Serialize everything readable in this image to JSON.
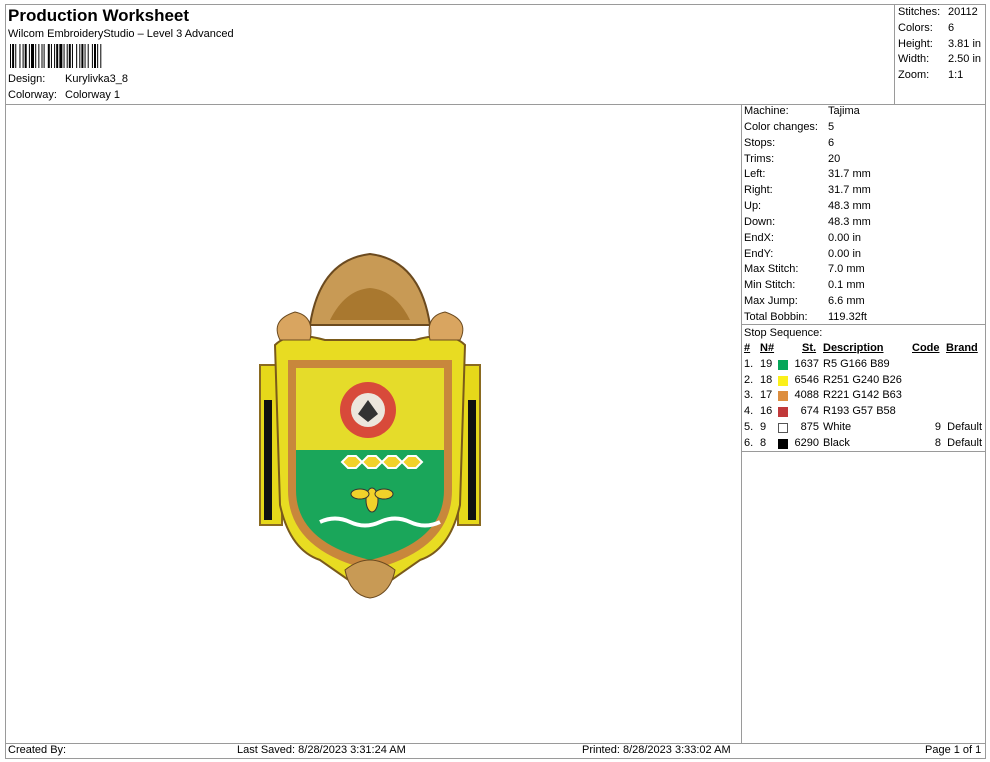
{
  "header": {
    "title": "Production Worksheet",
    "software": "Wilcom EmbroideryStudio – Level 3 Advanced",
    "design_label": "Design:",
    "design_value": "Kurylivka3_8",
    "colorway_label": "Colorway:",
    "colorway_value": "Colorway 1"
  },
  "summary": [
    {
      "label": "Stitches:",
      "value": "20112"
    },
    {
      "label": "Colors:",
      "value": "6"
    },
    {
      "label": "Height:",
      "value": "3.81 in"
    },
    {
      "label": "Width:",
      "value": "2.50 in"
    },
    {
      "label": "Zoom:",
      "value": "1:1"
    }
  ],
  "machine_stats": [
    {
      "label": "Machine:",
      "value": "Tajima"
    },
    {
      "label": "Color changes:",
      "value": "5"
    },
    {
      "label": "Stops:",
      "value": "6"
    },
    {
      "label": "Trims:",
      "value": "20"
    },
    {
      "label": "Left:",
      "value": "31.7 mm"
    },
    {
      "label": "Right:",
      "value": "31.7 mm"
    },
    {
      "label": "Up:",
      "value": "48.3 mm"
    },
    {
      "label": "Down:",
      "value": "48.3 mm"
    },
    {
      "label": "EndX:",
      "value": "0.00 in"
    },
    {
      "label": "EndY:",
      "value": "0.00 in"
    },
    {
      "label": "Max Stitch:",
      "value": "7.0 mm"
    },
    {
      "label": "Min Stitch:",
      "value": "0.1 mm"
    },
    {
      "label": "Max Jump:",
      "value": "6.6 mm"
    },
    {
      "label": "Total Bobbin:",
      "value": "119.32ft"
    }
  ],
  "stop_sequence": {
    "title": "Stop Sequence:",
    "headers": {
      "num": "#",
      "needle": "N#",
      "stitches": "St.",
      "description": "Description",
      "code": "Code",
      "brand": "Brand"
    },
    "rows": [
      {
        "num": "1.",
        "needle": "19",
        "color": "#05A659",
        "stitches": "1637",
        "description": "R5 G166 B89",
        "code": "",
        "brand": ""
      },
      {
        "num": "2.",
        "needle": "18",
        "color": "#FBF01A",
        "stitches": "6546",
        "description": "R251 G240 B26",
        "code": "",
        "brand": ""
      },
      {
        "num": "3.",
        "needle": "17",
        "color": "#DD8E3F",
        "stitches": "4088",
        "description": "R221 G142 B63",
        "code": "",
        "brand": ""
      },
      {
        "num": "4.",
        "needle": "16",
        "color": "#C1393A",
        "stitches": "674",
        "description": "R193 G57 B58",
        "code": "",
        "brand": ""
      },
      {
        "num": "5.",
        "needle": "9",
        "color": "#FFFFFF",
        "stitches": "875",
        "description": "White",
        "code": "9",
        "brand": "Default"
      },
      {
        "num": "6.",
        "needle": "8",
        "color": "#000000",
        "stitches": "6290",
        "description": "Black",
        "code": "8",
        "brand": "Default"
      }
    ]
  },
  "footer": {
    "created_by": "Created By:",
    "last_saved": "Last Saved: 8/28/2023 3:31:24 AM",
    "printed": "Printed: 8/28/2023 3:33:02 AM",
    "page": "Page 1 of 1"
  }
}
